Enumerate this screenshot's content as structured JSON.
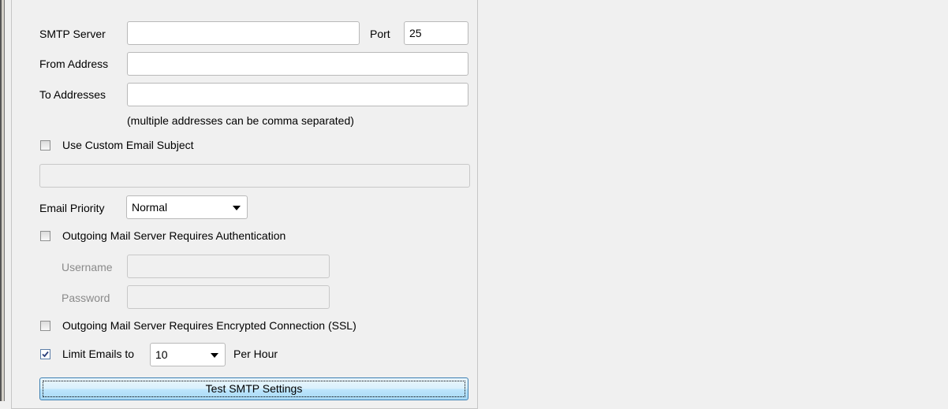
{
  "smtp": {
    "server_label": "SMTP Server",
    "server_value": "",
    "port_label": "Port",
    "port_value": "25",
    "from_label": "From Address",
    "from_value": "",
    "to_label": "To Addresses",
    "to_value": "",
    "to_hint": "(multiple addresses can be comma separated)"
  },
  "subject": {
    "checkbox_label": "Use Custom Email Subject",
    "checked": false,
    "value": ""
  },
  "priority": {
    "label": "Email Priority",
    "selected": "Normal"
  },
  "auth": {
    "checkbox_label": "Outgoing Mail Server Requires Authentication",
    "checked": false,
    "username_label": "Username",
    "username_value": "",
    "password_label": "Password",
    "password_value": ""
  },
  "ssl": {
    "checkbox_label": "Outgoing Mail Server Requires Encrypted Connection (SSL)",
    "checked": false
  },
  "limit": {
    "checkbox_label": "Limit Emails to",
    "checked": true,
    "selected": "10",
    "suffix": "Per Hour"
  },
  "test_button_label": "Test SMTP Settings"
}
